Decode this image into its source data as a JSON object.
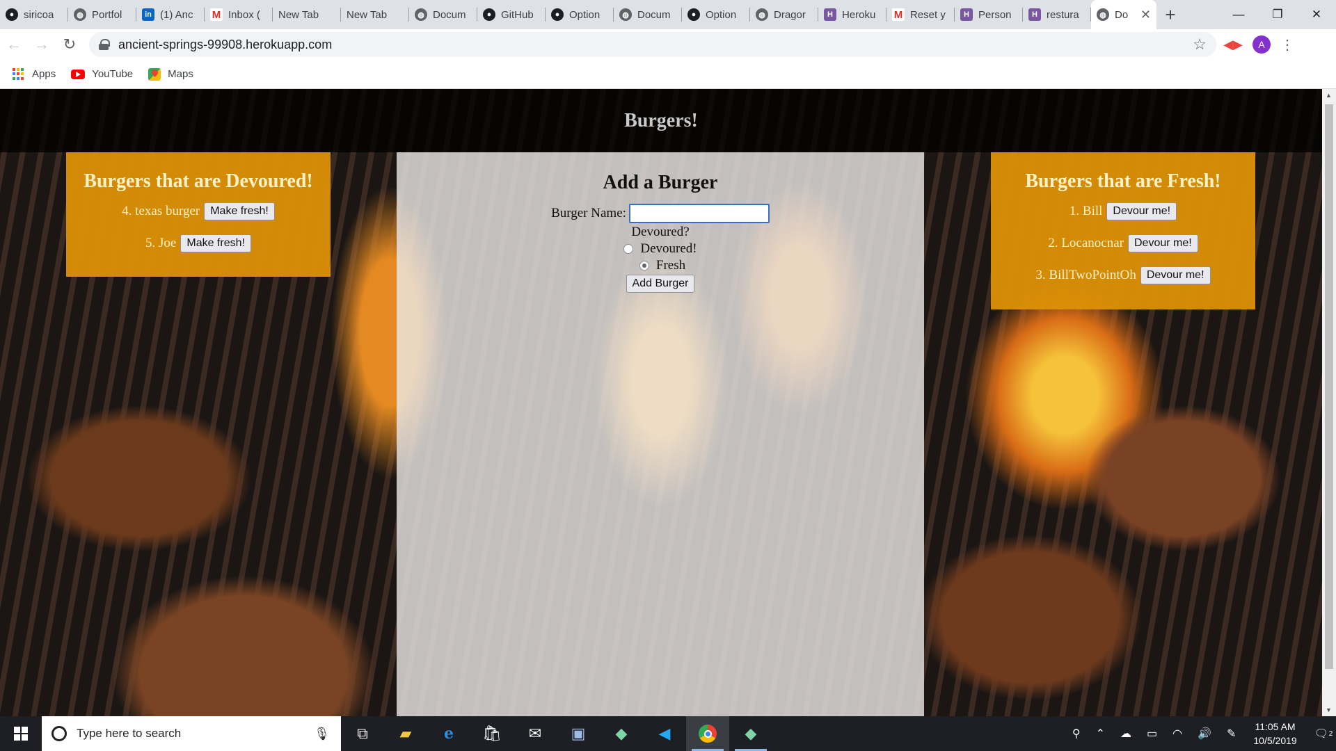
{
  "browser": {
    "tabs": [
      {
        "label": "siricoa",
        "icon": "github-icon"
      },
      {
        "label": "Portfol",
        "icon": "globe-icon"
      },
      {
        "label": "(1) Anc",
        "icon": "linkedin-icon"
      },
      {
        "label": "Inbox (",
        "icon": "gmail-icon"
      },
      {
        "label": "New Tab",
        "icon": ""
      },
      {
        "label": "New Tab",
        "icon": ""
      },
      {
        "label": "Docum",
        "icon": "globe-icon"
      },
      {
        "label": "GitHub",
        "icon": "github-icon"
      },
      {
        "label": "Option",
        "icon": "github-icon"
      },
      {
        "label": "Docum",
        "icon": "globe-icon"
      },
      {
        "label": "Option",
        "icon": "github-icon"
      },
      {
        "label": "Dragor",
        "icon": "globe-icon"
      },
      {
        "label": "Heroku",
        "icon": "heroku-icon"
      },
      {
        "label": "Reset y",
        "icon": "gmail-icon"
      },
      {
        "label": "Person",
        "icon": "heroku-icon"
      },
      {
        "label": "restura",
        "icon": "heroku-icon"
      }
    ],
    "active_tab": {
      "label": "Do",
      "icon": "globe-icon"
    },
    "url": "ancient-springs-99908.herokuapp.com",
    "avatar_letter": "A",
    "bookmarks": [
      {
        "label": "Apps",
        "icon": "apps-icon"
      },
      {
        "label": "YouTube",
        "icon": "youtube-icon"
      },
      {
        "label": "Maps",
        "icon": "maps-icon"
      }
    ]
  },
  "page": {
    "title": "Burgers!",
    "devoured": {
      "heading": "Burgers that are Devoured!",
      "button_label": "Make fresh!",
      "items": [
        {
          "name": "4. texas burger"
        },
        {
          "name": "5. Joe"
        }
      ]
    },
    "form": {
      "heading": "Add a Burger",
      "name_label": "Burger Name:",
      "name_value": "",
      "status_label": "Devoured?",
      "option_devoured": "Devoured!",
      "option_fresh": "Fresh",
      "selected_option": "Fresh",
      "submit_label": "Add Burger"
    },
    "fresh": {
      "heading": "Burgers that are Fresh!",
      "button_label": "Devour me!",
      "items": [
        {
          "name": "1. Bill"
        },
        {
          "name": "2. Locanocnar"
        },
        {
          "name": "3. BillTwoPointOh"
        }
      ]
    }
  },
  "taskbar": {
    "search_placeholder": "Type here to search",
    "time": "11:05 AM",
    "date": "10/5/2019",
    "notification_count": "2",
    "apps": [
      "task-view-icon",
      "file-explorer-icon",
      "edge-icon",
      "store-icon",
      "mail-icon",
      "visual-studio-icon",
      "gitkraken-icon",
      "vscode-icon",
      "chrome-icon",
      "gitkraken-icon"
    ]
  },
  "colors": {
    "panel_bg": "#de9206",
    "header_bg": "#000000",
    "center_bg": "#eceae8",
    "input_border": "#3b6fc4"
  }
}
